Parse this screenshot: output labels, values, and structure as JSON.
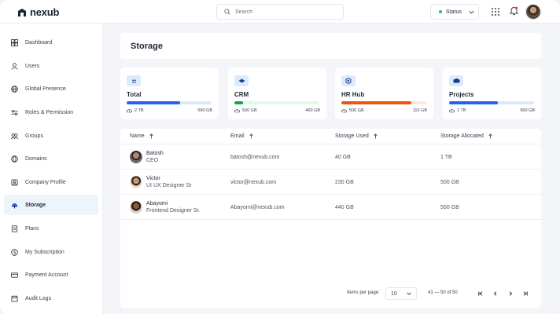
{
  "app": {
    "name": "nexub"
  },
  "header": {
    "search_placeholder": "Search",
    "status_label": "Status"
  },
  "sidebar": {
    "items": [
      {
        "label": "Dashboard",
        "icon": "dashboard-icon"
      },
      {
        "label": "Users",
        "icon": "users-icon"
      },
      {
        "label": "Global Presence",
        "icon": "globe-icon"
      },
      {
        "label": "Roles & Permission",
        "icon": "sliders-icon"
      },
      {
        "label": "Groups",
        "icon": "groups-icon"
      },
      {
        "label": "Domains",
        "icon": "domain-globe-icon"
      },
      {
        "label": "Company Profile",
        "icon": "company-icon"
      },
      {
        "label": "Storage",
        "icon": "cloud-icon",
        "active": true
      },
      {
        "label": "Plans",
        "icon": "plans-icon"
      },
      {
        "label": "My Subscription",
        "icon": "subscription-icon"
      },
      {
        "label": "Payment Account",
        "icon": "payment-icon"
      },
      {
        "label": "Audit Logs",
        "icon": "audit-icon"
      }
    ]
  },
  "page": {
    "title": "Storage"
  },
  "cards": [
    {
      "title": "Total",
      "icon": "total-icon",
      "used": "2 TB",
      "total": "590 GB",
      "progress": 0.63,
      "color": "#2563eb",
      "track": "#dbe7fb",
      "icon_bg": "#dbeafe"
    },
    {
      "title": "CRM",
      "icon": "crm-icon",
      "used": "500 GB",
      "total": "400 GB",
      "progress": 0.1,
      "color": "#16a34a",
      "track": "#dcfce7",
      "icon_bg": "#dbeafe"
    },
    {
      "title": "HR Hub",
      "icon": "hr-hub-icon",
      "used": "500 GB",
      "total": "110 GB",
      "progress": 0.82,
      "color": "#ea580c",
      "track": "#fde8dd",
      "icon_bg": "#dbeafe"
    },
    {
      "title": "Projects",
      "icon": "projects-icon",
      "used": "1 TB",
      "total": "900 GB",
      "progress": 0.57,
      "color": "#2563eb",
      "track": "#dbe7fb",
      "icon_bg": "#dbeafe"
    }
  ],
  "table": {
    "columns": [
      "Name",
      "Email",
      "Storage Used",
      "Storage Allocated"
    ],
    "rows": [
      {
        "name": "Batosh",
        "role": "CEO",
        "email": "batosh@nexub.com",
        "used": "40 GB",
        "allocated": "1 TB"
      },
      {
        "name": "Victor",
        "role": "UI UX Designer Sr",
        "email": "victor@nexub.com",
        "used": "230 GB",
        "allocated": "500 GB"
      },
      {
        "name": "Abayomi",
        "role": "Frontend Designer Sr.",
        "email": "Abayomi@nexub.com",
        "used": "440 GB",
        "allocated": "500 GB"
      }
    ]
  },
  "pagination": {
    "items_label": "Items per page:",
    "per_page": "10",
    "range": "41 — 50 of 50"
  }
}
